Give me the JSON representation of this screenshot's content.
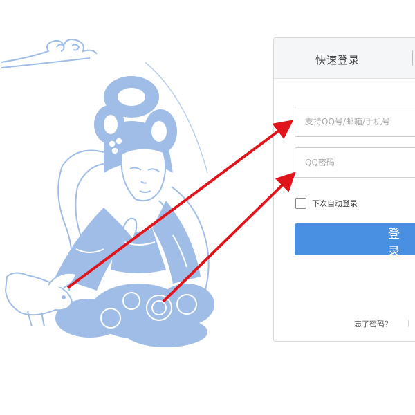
{
  "login": {
    "tab_quick": "快速登录",
    "account_placeholder": "支持QQ号/邮箱/手机号",
    "password_placeholder": "QQ密码",
    "remember_label": "下次自动登录",
    "login_button": "登 录",
    "forgot_link": "忘了密码？",
    "forgot_separator": "|"
  },
  "colors": {
    "illustration": "#9fbde6",
    "arrow": "#e0141b",
    "button": "#4a90e2"
  }
}
